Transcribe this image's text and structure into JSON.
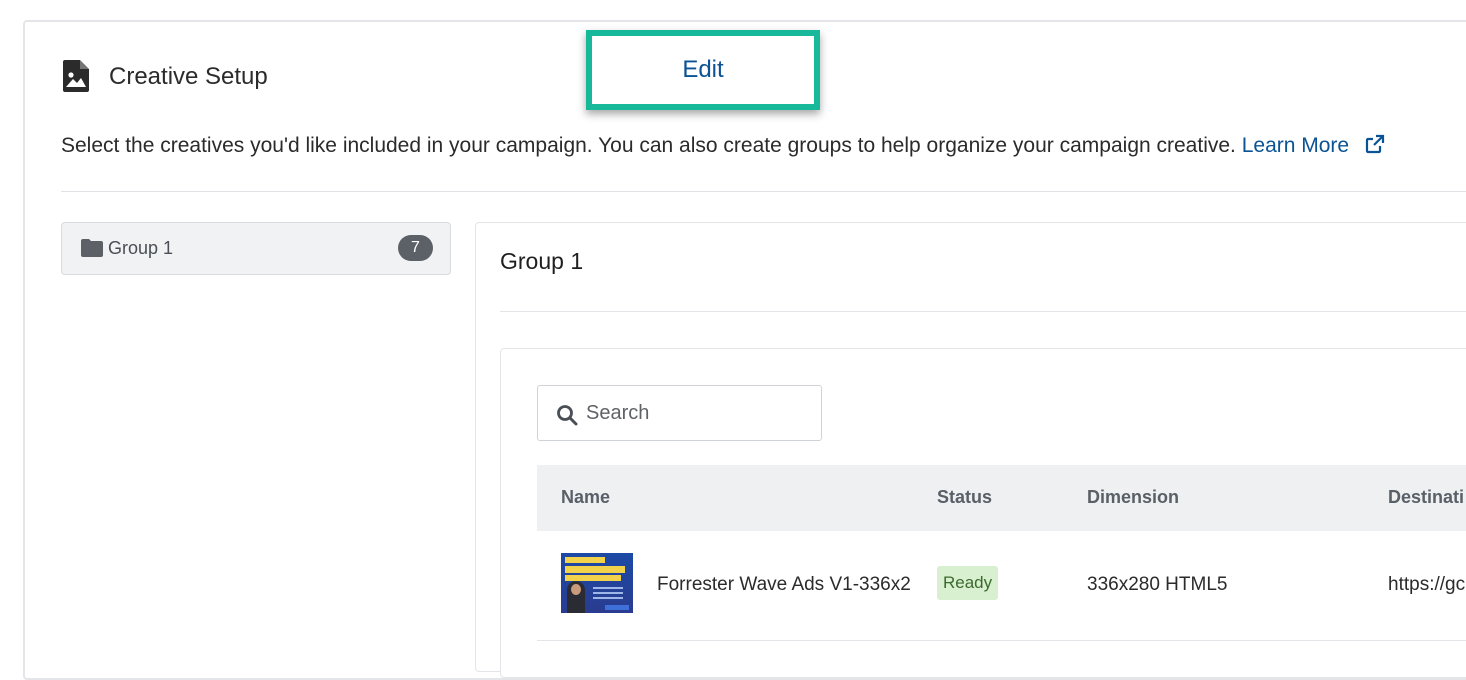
{
  "header": {
    "title": "Creative Setup",
    "icon": "image-file-icon",
    "edit_label": "Edit"
  },
  "description": {
    "text": "Select the creatives you'd like included in your campaign. You can also create groups to help organize your campaign creative.",
    "learn_more": "Learn More",
    "link_icon": "external-link-icon"
  },
  "groups": {
    "items": [
      {
        "label": "Group 1",
        "count": "7",
        "icon": "folder-icon"
      }
    ]
  },
  "panel": {
    "title": "Group 1",
    "search": {
      "placeholder": "Search",
      "value": ""
    },
    "table": {
      "columns": [
        "Name",
        "Status",
        "Dimension",
        "Destinati"
      ],
      "rows": [
        {
          "name": "Forrester Wave Ads V1-336x2",
          "status": "Ready",
          "dimension": "336x280 HTML5",
          "destination": "https://gc"
        }
      ]
    }
  },
  "colors": {
    "accent_link": "#0b5394",
    "highlight_border": "#17b99a",
    "badge_bg": "#d8f0d0",
    "badge_text": "#3b6a2e",
    "count_bg": "#5c6167"
  }
}
